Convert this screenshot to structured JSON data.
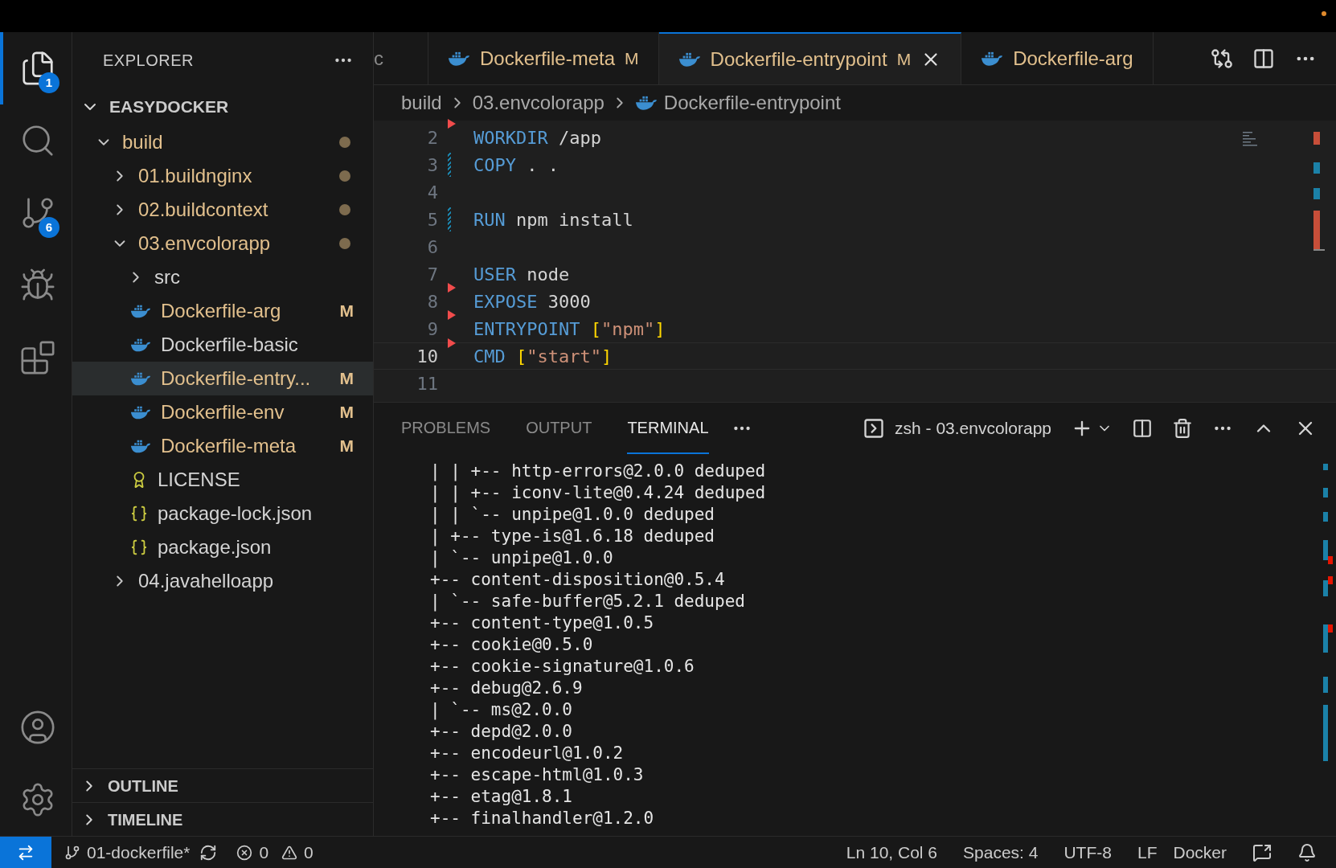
{
  "activity_bar": {
    "items": [
      {
        "kind": "explorer",
        "selected": true,
        "badge": "1"
      },
      {
        "kind": "search",
        "selected": false
      },
      {
        "kind": "scm",
        "selected": false,
        "badge": "6"
      },
      {
        "kind": "debug",
        "selected": false
      },
      {
        "kind": "extensions",
        "selected": false
      }
    ],
    "bottom": [
      {
        "kind": "account"
      },
      {
        "kind": "settings"
      }
    ]
  },
  "sidebar": {
    "title": "EXPLORER",
    "root": {
      "label": "EASYDOCKER",
      "expanded": true
    },
    "tree": [
      {
        "label": "build",
        "kind": "folder",
        "expanded": true,
        "modified": true,
        "selected": false,
        "children": [
          {
            "label": "01.buildnginx",
            "kind": "folder",
            "expanded": false,
            "modified": true,
            "selected": false
          },
          {
            "label": "02.buildcontext",
            "kind": "folder",
            "expanded": false,
            "modified": true,
            "selected": false
          },
          {
            "label": "03.envcolorapp",
            "kind": "folder",
            "expanded": true,
            "modified": true,
            "selected": false,
            "children": [
              {
                "label": "src",
                "kind": "folder",
                "expanded": false,
                "modified": false,
                "selected": false
              },
              {
                "label": "Dockerfile-arg",
                "kind": "docker",
                "modified": true,
                "badge": "M",
                "selected": false
              },
              {
                "label": "Dockerfile-basic",
                "kind": "docker",
                "modified": false,
                "selected": false
              },
              {
                "label": "Dockerfile-entry...",
                "kind": "docker",
                "modified": true,
                "badge": "M",
                "selected": true
              },
              {
                "label": "Dockerfile-env",
                "kind": "docker",
                "modified": true,
                "badge": "M",
                "selected": false
              },
              {
                "label": "Dockerfile-meta",
                "kind": "docker",
                "modified": true,
                "badge": "M",
                "selected": false
              },
              {
                "label": "LICENSE",
                "kind": "license",
                "modified": false,
                "selected": false
              },
              {
                "label": "package-lock.json",
                "kind": "json",
                "modified": false,
                "selected": false
              },
              {
                "label": "package.json",
                "kind": "json",
                "modified": false,
                "selected": false
              }
            ]
          },
          {
            "label": "04.javahelloapp",
            "kind": "folder",
            "expanded": false,
            "modified": false,
            "selected": false
          }
        ]
      }
    ],
    "sections": [
      {
        "label": "OUTLINE",
        "expanded": false
      },
      {
        "label": "TIMELINE",
        "expanded": false
      }
    ]
  },
  "tabs": [
    {
      "label": "c",
      "kind": "plain",
      "selected": false
    },
    {
      "label": "Dockerfile-meta",
      "kind": "docker",
      "badge": "M",
      "selected": false
    },
    {
      "label": "Dockerfile-entrypoint",
      "kind": "docker",
      "badge": "M",
      "selected": true
    },
    {
      "label": "Dockerfile-arg",
      "kind": "docker",
      "selected": false
    }
  ],
  "breadcrumb": [
    "build",
    "03.envcolorapp",
    "Dockerfile-entrypoint"
  ],
  "editor": {
    "lines": [
      {
        "number": "2",
        "current": false,
        "deleted": true,
        "modified": false,
        "tokens": [
          {
            "kind": "keyword",
            "text": "WORKDIR"
          },
          {
            "kind": "text",
            "text": " /app"
          }
        ]
      },
      {
        "number": "3",
        "current": false,
        "deleted": false,
        "modified": true,
        "tokens": [
          {
            "kind": "keyword",
            "text": "COPY"
          },
          {
            "kind": "text",
            "text": " . ."
          }
        ]
      },
      {
        "number": "4",
        "current": false,
        "deleted": false,
        "modified": false
      },
      {
        "number": "5",
        "current": false,
        "deleted": false,
        "modified": true,
        "tokens": [
          {
            "kind": "keyword",
            "text": "RUN"
          },
          {
            "kind": "text",
            "text": " npm install"
          }
        ]
      },
      {
        "number": "6",
        "current": false,
        "deleted": false,
        "modified": false
      },
      {
        "number": "7",
        "current": false,
        "deleted": false,
        "modified": false,
        "tokens": [
          {
            "kind": "keyword",
            "text": "USER"
          },
          {
            "kind": "text",
            "text": " node"
          }
        ]
      },
      {
        "number": "8",
        "current": false,
        "deleted": true,
        "modified": false,
        "tokens": [
          {
            "kind": "keyword",
            "text": "EXPOSE"
          },
          {
            "kind": "text",
            "text": " 3000"
          }
        ]
      },
      {
        "number": "9",
        "current": false,
        "deleted": true,
        "modified": false,
        "tokens": [
          {
            "kind": "keyword",
            "text": "ENTRYPOINT"
          },
          {
            "kind": "bracket",
            "text": " ["
          },
          {
            "kind": "string",
            "text": "\"npm\""
          },
          {
            "kind": "bracket",
            "text": "]"
          }
        ]
      },
      {
        "number": "10",
        "current": true,
        "deleted": true,
        "modified": false,
        "tokens": [
          {
            "kind": "keyword",
            "text": "CMD"
          },
          {
            "kind": "bracket",
            "text": " ["
          },
          {
            "kind": "string",
            "text": "\"start\""
          },
          {
            "kind": "bracket",
            "text": "]"
          }
        ]
      },
      {
        "number": "11",
        "current": false,
        "deleted": false,
        "modified": false
      }
    ]
  },
  "panel": {
    "tabs": [
      {
        "label": "PROBLEMS",
        "selected": false
      },
      {
        "label": "OUTPUT",
        "selected": false
      },
      {
        "label": "TERMINAL",
        "selected": true
      }
    ],
    "terminal_name": "zsh - 03.envcolorapp",
    "terminal_lines": [
      "| | +-- http-errors@2.0.0 deduped",
      "| | +-- iconv-lite@0.4.24 deduped",
      "| | `-- unpipe@1.0.0 deduped",
      "| +-- type-is@1.6.18 deduped",
      "| `-- unpipe@1.0.0",
      "+-- content-disposition@0.5.4",
      "| `-- safe-buffer@5.2.1 deduped",
      "+-- content-type@1.0.5",
      "+-- cookie@0.5.0",
      "+-- cookie-signature@1.0.6",
      "+-- debug@2.6.9",
      "| `-- ms@2.0.0",
      "+-- depd@2.0.0",
      "+-- encodeurl@1.0.2",
      "+-- escape-html@1.0.3",
      "+-- etag@1.8.1",
      "+-- finalhandler@1.2.0"
    ]
  },
  "status_bar": {
    "branch": "01-dockerfile*",
    "errors": "0",
    "warnings": "0",
    "position": "Ln 10, Col 6",
    "indent": "Spaces: 4",
    "encoding": "UTF-8",
    "eol": "LF",
    "language": "Docker"
  }
}
